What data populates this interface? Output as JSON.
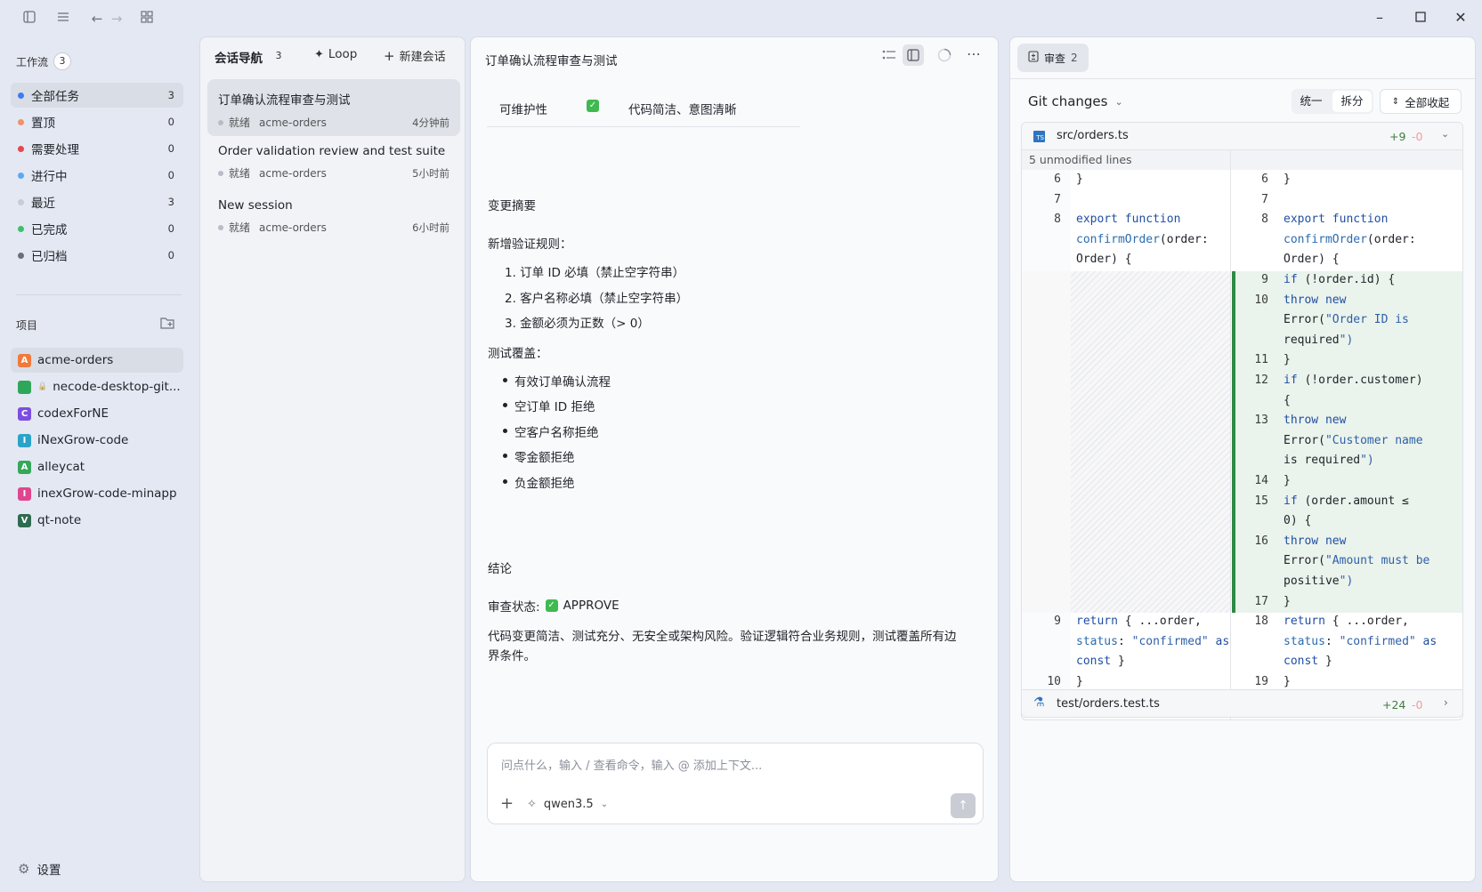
{
  "sidebar": {
    "workflow_label": "工作流",
    "workflow_count": "3",
    "nav": [
      {
        "label": "全部任务",
        "count": "3",
        "color": "#3d7bf7"
      },
      {
        "label": "置顶",
        "count": "0",
        "color": "#f0936a"
      },
      {
        "label": "需要处理",
        "count": "0",
        "color": "#e5484d"
      },
      {
        "label": "进行中",
        "count": "0",
        "color": "#5aa9f7"
      },
      {
        "label": "最近",
        "count": "3",
        "color": "#c9ccd3"
      },
      {
        "label": "已完成",
        "count": "0",
        "color": "#3fbf6c"
      },
      {
        "label": "已归档",
        "count": "0",
        "color": "#6b6f78"
      }
    ],
    "projects_label": "项目",
    "projects": [
      {
        "letter": "A",
        "label": "acme-orders",
        "color": "#f07a3c"
      },
      {
        "letter": "",
        "label": "necode-desktop-git...",
        "color": "#2fa75b"
      },
      {
        "letter": "C",
        "label": "codexForNE",
        "color": "#7c4ddf"
      },
      {
        "letter": "I",
        "label": "iNexGrow-code",
        "color": "#2aa3c9"
      },
      {
        "letter": "A",
        "label": "alleycat",
        "color": "#35a85a"
      },
      {
        "letter": "I",
        "label": "inexGrow-code-minapp",
        "color": "#e0458f"
      },
      {
        "letter": "V",
        "label": "qt-note",
        "color": "#2e6b4f"
      }
    ],
    "settings_label": "设置"
  },
  "sessions": {
    "title": "会话导航",
    "count": "3",
    "loop_label": "Loop",
    "new_label": "新建会话",
    "items": [
      {
        "title": "订单确认流程审查与测试",
        "status": "就绪",
        "repo": "acme-orders",
        "time": "4分钟前"
      },
      {
        "title": "Order validation review and test suite",
        "status": "就绪",
        "repo": "acme-orders",
        "time": "5小时前"
      },
      {
        "title": "New session",
        "status": "就绪",
        "repo": "acme-orders",
        "time": "6小时前"
      }
    ]
  },
  "chat": {
    "title": "订单确认流程审查与测试",
    "table_row": {
      "col1": "可维护性",
      "col3": "代码简洁、意图清晰"
    },
    "summary_heading": "变更摘要",
    "rules_heading": "新增验证规则：",
    "rules": [
      "1. 订单 ID 必填（禁止空字符串）",
      "2. 客户名称必填（禁止空字符串）",
      "3. 金额必须为正数（> 0）"
    ],
    "tests_heading": "测试覆盖：",
    "tests": [
      "有效订单确认流程",
      "空订单 ID 拒绝",
      "空客户名称拒绝",
      "零金额拒绝",
      "负金额拒绝"
    ],
    "conclusion_heading": "结论",
    "review_label": "审查状态:",
    "review_value": "APPROVE",
    "conclusion_text_1": "代码变更简洁、测试充分、无安全或架构风险。验证逻辑符合业务规则，测试覆盖所有边",
    "conclusion_text_2": "界条件。",
    "input_placeholder": "问点什么，输入 / 查看命令，输入 @ 添加上下文...",
    "model": "qwen3.5"
  },
  "review": {
    "tab_label": "审查",
    "tab_count": "2",
    "git_changes": "Git changes",
    "btn_unified": "统一",
    "btn_split": "拆分",
    "btn_collapse": "全部收起",
    "file1": {
      "name": "src/orders.ts",
      "add": "+9",
      "del": "-0"
    },
    "unmodified": "5 unmodified lines",
    "file2": {
      "name": "test/orders.test.ts",
      "add": "+24",
      "del": "-0"
    },
    "left_lines": [
      {
        "n": "6",
        "code": "}"
      },
      {
        "n": "7",
        "code": ""
      },
      {
        "n": "8",
        "code": "export function"
      },
      {
        "n": "",
        "code": "confirmOrder(order:"
      },
      {
        "n": "",
        "code": "Order) {"
      },
      {
        "n": "9",
        "code": "  return { ...order,"
      },
      {
        "n": "",
        "code": "status: \"confirmed\" as"
      },
      {
        "n": "",
        "code": "const }"
      },
      {
        "n": "10",
        "code": "}"
      }
    ],
    "right_lines": [
      {
        "n": "6",
        "code": "}"
      },
      {
        "n": "7",
        "code": ""
      },
      {
        "n": "8",
        "code": "export function"
      },
      {
        "n": "",
        "code": "confirmOrder(order:"
      },
      {
        "n": "",
        "code": "Order) {"
      },
      {
        "n": "9",
        "code": "  if (!order.id) {"
      },
      {
        "n": "10",
        "code": "    throw new"
      },
      {
        "n": "",
        "code": "Error(\"Order ID is"
      },
      {
        "n": "",
        "code": "required\")"
      },
      {
        "n": "11",
        "code": "  }"
      },
      {
        "n": "12",
        "code": "  if (!order.customer)"
      },
      {
        "n": "",
        "code": "{"
      },
      {
        "n": "13",
        "code": "    throw new"
      },
      {
        "n": "",
        "code": "Error(\"Customer name"
      },
      {
        "n": "",
        "code": "is required\")"
      },
      {
        "n": "14",
        "code": "  }"
      },
      {
        "n": "15",
        "code": "  if (order.amount ≤"
      },
      {
        "n": "",
        "code": "0) {"
      },
      {
        "n": "16",
        "code": "    throw new"
      },
      {
        "n": "",
        "code": "Error(\"Amount must be"
      },
      {
        "n": "",
        "code": "positive\")"
      },
      {
        "n": "17",
        "code": "  }"
      },
      {
        "n": "18",
        "code": "  return { ...order,"
      },
      {
        "n": "",
        "code": "status: \"confirmed\" as"
      },
      {
        "n": "",
        "code": "const }"
      },
      {
        "n": "19",
        "code": "}"
      }
    ]
  }
}
